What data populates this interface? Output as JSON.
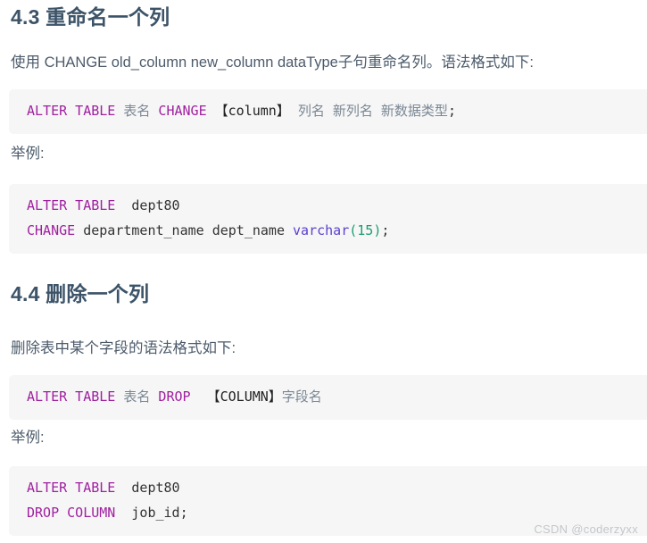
{
  "document": {
    "sections": [
      {
        "id": "4.3",
        "heading": "4.3 重命名一个列",
        "intro": "使用 CHANGE old_column new_column dataType子句重命名列。语法格式如下:",
        "syntax_code": {
          "line1": {
            "kw1": "ALTER TABLE",
            "cn1": "表名",
            "kw2": "CHANGE",
            "bracket": "【column】",
            "cn2": "列名 新列名 新数据类型",
            "semicolon": ";"
          }
        },
        "example_label": "举例:",
        "example_code": {
          "line1_kw": "ALTER TABLE",
          "line1_obj": "dept80",
          "line2_kw": "CHANGE",
          "line2_cols": "department_name dept_name",
          "line2_type": "varchar",
          "line2_open": "(",
          "line2_num": "15",
          "line2_close": ")",
          "line2_semi": ";"
        }
      },
      {
        "id": "4.4",
        "heading": "4.4 删除一个列",
        "intro": "删除表中某个字段的语法格式如下:",
        "syntax_code": {
          "line1": {
            "kw1": "ALTER TABLE",
            "cn1": "表名",
            "kw2": "DROP",
            "bracket": "【COLUMN】",
            "cn2": "字段名"
          }
        },
        "example_label": "举例:",
        "example_code": {
          "line1_kw": "ALTER TABLE",
          "line1_obj": "dept80",
          "line2_kw": "DROP COLUMN",
          "line2_obj": "job_id",
          "line2_semi": ";"
        }
      }
    ]
  },
  "watermark": {
    "text": "CSDN @coderzyxx"
  },
  "colors": {
    "heading": "#3c5368",
    "body_text": "#4c5b6b",
    "code_background": "#f6f6f6",
    "keyword": "#a020a0",
    "chinese_token": "#7a8794",
    "type_token": "#5b3fd0",
    "paren_token": "#1a9e6e",
    "watermark": "#c3c7cb",
    "page_background": "#ffffff"
  }
}
